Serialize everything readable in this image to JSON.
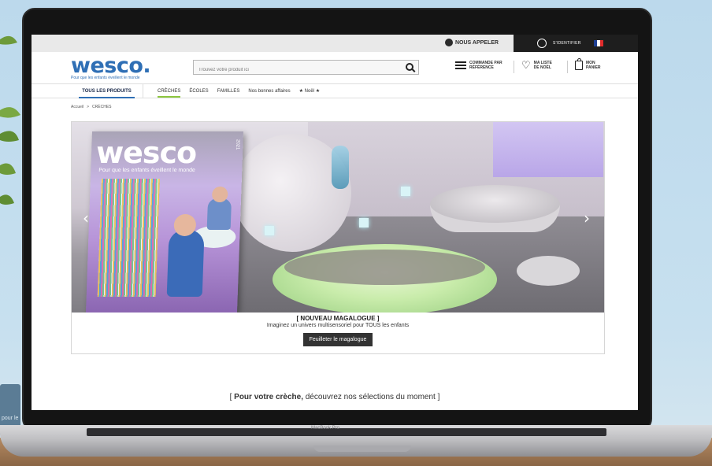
{
  "topbar": {
    "call_label": "NOUS APPELER",
    "account_label": "S'IDENTIFIER",
    "flag_colors": [
      "#1d3f94",
      "#ffffff",
      "#e02b2b"
    ]
  },
  "logo": {
    "name": "wesco.",
    "tagline": "Pour que les enfants éveillent le monde"
  },
  "search": {
    "placeholder": "Trouvez votre produit ici"
  },
  "header_actions": {
    "order_ref": "COMMANDE PAR RÉFÉRENCE",
    "wishlist": "MA LISTE DE NOËL",
    "cart": "MON PANIER"
  },
  "nav": {
    "all_products": "TOUS LES PRODUITS",
    "items": [
      "CRÈCHES",
      "ÉCOLES",
      "FAMILLES",
      "Nos bonnes affaires",
      "★ Noël ★"
    ],
    "active_index": 0
  },
  "breadcrumb": {
    "home": "Accueil",
    "separator": ">",
    "current": "CRÈCHES"
  },
  "hero": {
    "magazine_logo": "wesco",
    "magazine_tagline": "Pour que les enfants éveillent le monde",
    "magazine_year": "2021",
    "title": "[ NOUVEAU MAGALOGUE ]",
    "subtitle": "Imaginez un univers multisensoriel pour TOUS les enfants",
    "button": "Feuilleter le magalogue",
    "prev_arrow": "‹",
    "next_arrow": "›"
  },
  "section": {
    "bracket_open": "[ ",
    "bold_part": "Pour votre crèche,",
    "rest": " découvrez nos sélections du moment ]"
  },
  "device": {
    "keyboard_label": "MacBook Pro"
  },
  "colors": {
    "brand_blue": "#2f6fb5",
    "active_green": "#8dc63f",
    "dark": "#1e1e1e"
  }
}
